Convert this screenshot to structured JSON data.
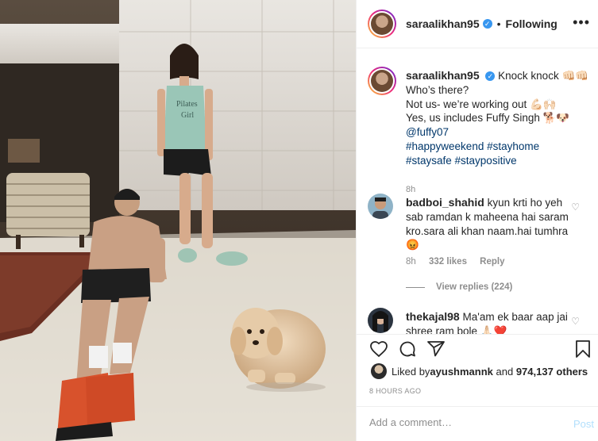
{
  "post": {
    "username": "saraalikhan95",
    "verified_glyph": "✓",
    "separator": "•",
    "follow_status": "Following",
    "more_glyph": "•••"
  },
  "caption": {
    "username": "saraalikhan95",
    "line1": "Knock knock 👊🏻👊🏻",
    "line2": "Who’s there?",
    "line3": "Not us- we’re working out 💪🏻🙌🏻",
    "line4": "Yes, us includes Fuffy Singh 🐕🐶",
    "mention": "@fuffy07",
    "hashtags1": "#happyweekend #stayhome",
    "hashtags2": "#staysafe #staypositive",
    "time": "8h"
  },
  "comments": [
    {
      "username": "badboi_shahid",
      "text": "kyun krti ho yeh sab ramdan k maheena hai saram kro.sara ali khan naam.hai tumhra😡",
      "time": "8h",
      "likes": "332 likes",
      "reply_label": "Reply",
      "view_replies": "View replies (224)"
    },
    {
      "username": "thekajal98",
      "text": "Ma'am ek baar aap jai",
      "text2": "shree ram bole 🙏🏻❤️"
    }
  ],
  "likes": {
    "prefix": "Liked by ",
    "user": "ayushmannk",
    "middle": " and ",
    "count": "974,137 others"
  },
  "timestamp": "8 HOURS AGO",
  "composer": {
    "placeholder": "Add a comment…",
    "post_label": "Post"
  },
  "icons": {
    "like": "heart-icon",
    "comment": "comment-icon",
    "share": "share-icon",
    "save": "bookmark-icon"
  }
}
